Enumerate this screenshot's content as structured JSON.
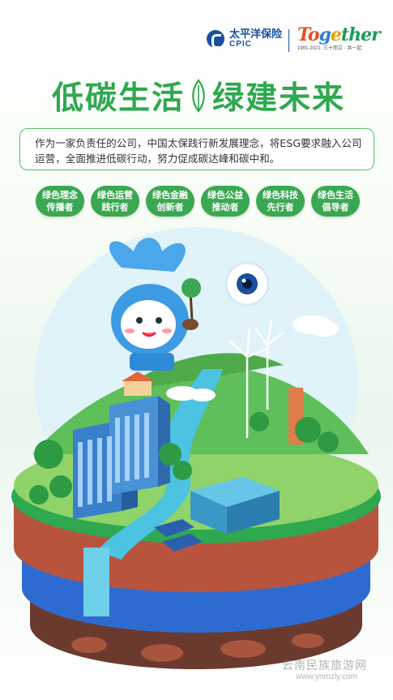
{
  "brand": {
    "name_cn": "太平洋保险",
    "name_en": "CPIC"
  },
  "campaign_logo": {
    "word_parts": [
      "To",
      "g",
      "e",
      "ther"
    ],
    "years": "1991-2021",
    "tagline": "三十而立 · 共一起"
  },
  "headline": {
    "part1": "低碳生活",
    "part2": "绿建未来"
  },
  "intro": {
    "text": "作为一家负责任的公司，中国太保践行新发展理念，将ESG要求融入公司运营，全面推进低碳行动，努力促成碳达峰和碳中和。"
  },
  "pills": [
    {
      "line1": "绿色理念",
      "line2": "传播者"
    },
    {
      "line1": "绿色运营",
      "line2": "践行者"
    },
    {
      "line1": "绿色金融",
      "line2": "创新者"
    },
    {
      "line1": "绿色公益",
      "line2": "推动者"
    },
    {
      "line1": "绿色科技",
      "line2": "先行者"
    },
    {
      "line1": "绿色生活",
      "line2": "倡导者"
    }
  ],
  "watermark": {
    "text": "云南民族旅游网",
    "url": "www.ynmzly.com"
  },
  "colors": {
    "green": "#2fa84f",
    "pill_green": "#3aa852",
    "brand_blue": "#1a4fa0",
    "soil_red": "#b8543e",
    "layer_blue": "#2e6bd0"
  }
}
